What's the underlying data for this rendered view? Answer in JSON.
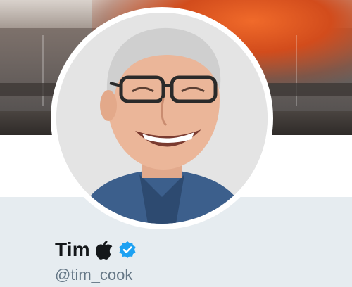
{
  "profile": {
    "display_name": "Tim",
    "handle": "@tim_cook",
    "badges": [
      "apple-icon",
      "verified-badge-icon"
    ]
  },
  "colors": {
    "name_text": "#14171a",
    "handle_text": "#657786",
    "verified_blue": "#1da1f2",
    "page_background": "#e6ecf0"
  }
}
